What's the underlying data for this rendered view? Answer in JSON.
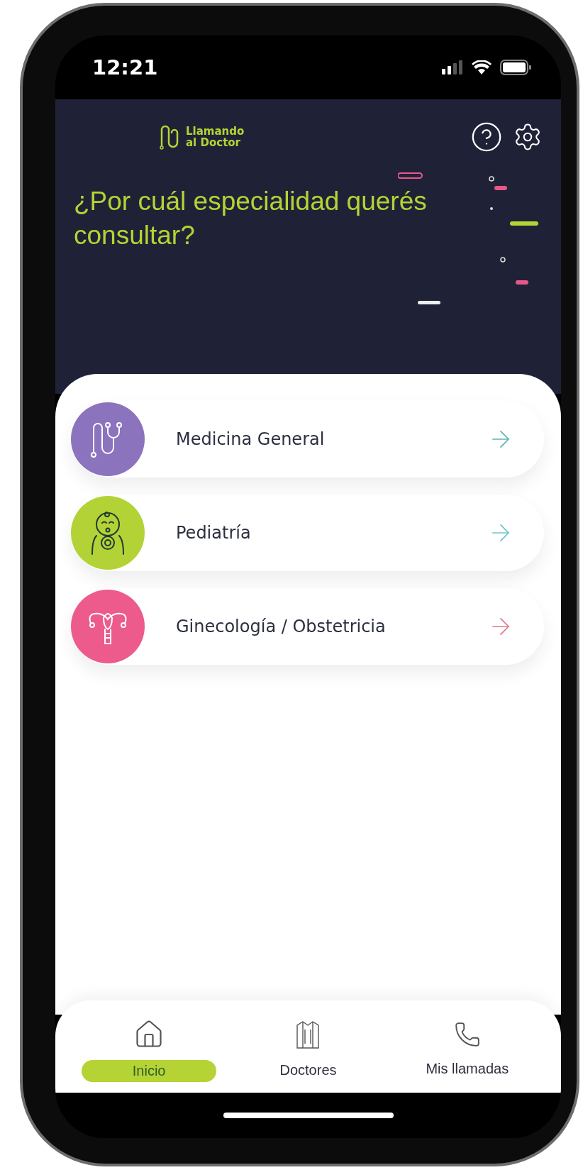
{
  "status_bar": {
    "time": "12:21"
  },
  "header": {
    "logo_lines": [
      "Llamando",
      "al Doctor"
    ],
    "title": "¿Por cuál especialidad querés consultar?"
  },
  "specialties": [
    {
      "name": "Medicina General",
      "kind": "stethoscope",
      "color": "#8b73bd"
    },
    {
      "name": "Pediatría",
      "kind": "baby",
      "color": "#b3d236"
    },
    {
      "name": "Ginecología / Obstetricia",
      "kind": "uterus",
      "color": "#ec5b8b"
    }
  ],
  "nav": [
    {
      "label": "Inicio",
      "kind": "home",
      "selected": true
    },
    {
      "label": "Doctores",
      "kind": "coat",
      "selected": false
    },
    {
      "label": "Mis llamadas",
      "kind": "phone",
      "selected": false
    }
  ]
}
